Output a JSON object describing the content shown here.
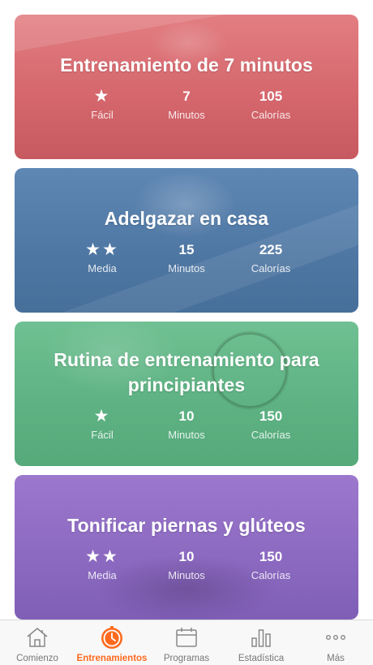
{
  "workouts": [
    {
      "title": "Entrenamiento de 7 minutos",
      "stars": "★",
      "level": "Fácil",
      "minutes": "7",
      "minutes_label": "Minutos",
      "calories": "105",
      "calories_label": "Calorías"
    },
    {
      "title": "Adelgazar en casa",
      "stars": "★★",
      "level": "Media",
      "minutes": "15",
      "minutes_label": "Minutos",
      "calories": "225",
      "calories_label": "Calorías"
    },
    {
      "title": "Rutina de entrenamiento para principiantes",
      "stars": "★",
      "level": "Fácil",
      "minutes": "10",
      "minutes_label": "Minutos",
      "calories": "150",
      "calories_label": "Calorías"
    },
    {
      "title": "Tonificar piernas y glúteos",
      "stars": "★★",
      "level": "Media",
      "minutes": "10",
      "minutes_label": "Minutos",
      "calories": "150",
      "calories_label": "Calorías"
    }
  ],
  "tabs": [
    {
      "label": "Comienzo",
      "icon": "home-icon"
    },
    {
      "label": "Entrenamientos",
      "icon": "stopwatch-icon",
      "active": true
    },
    {
      "label": "Programas",
      "icon": "calendar-icon"
    },
    {
      "label": "Estadística",
      "icon": "bar-chart-icon"
    },
    {
      "label": "Más",
      "icon": "more-icon"
    }
  ],
  "colors": {
    "accent": "#ff6a1f",
    "card_red": "#d5676d",
    "card_blue": "#4f77a3",
    "card_green": "#5db182",
    "card_purple": "#8b69c0"
  }
}
